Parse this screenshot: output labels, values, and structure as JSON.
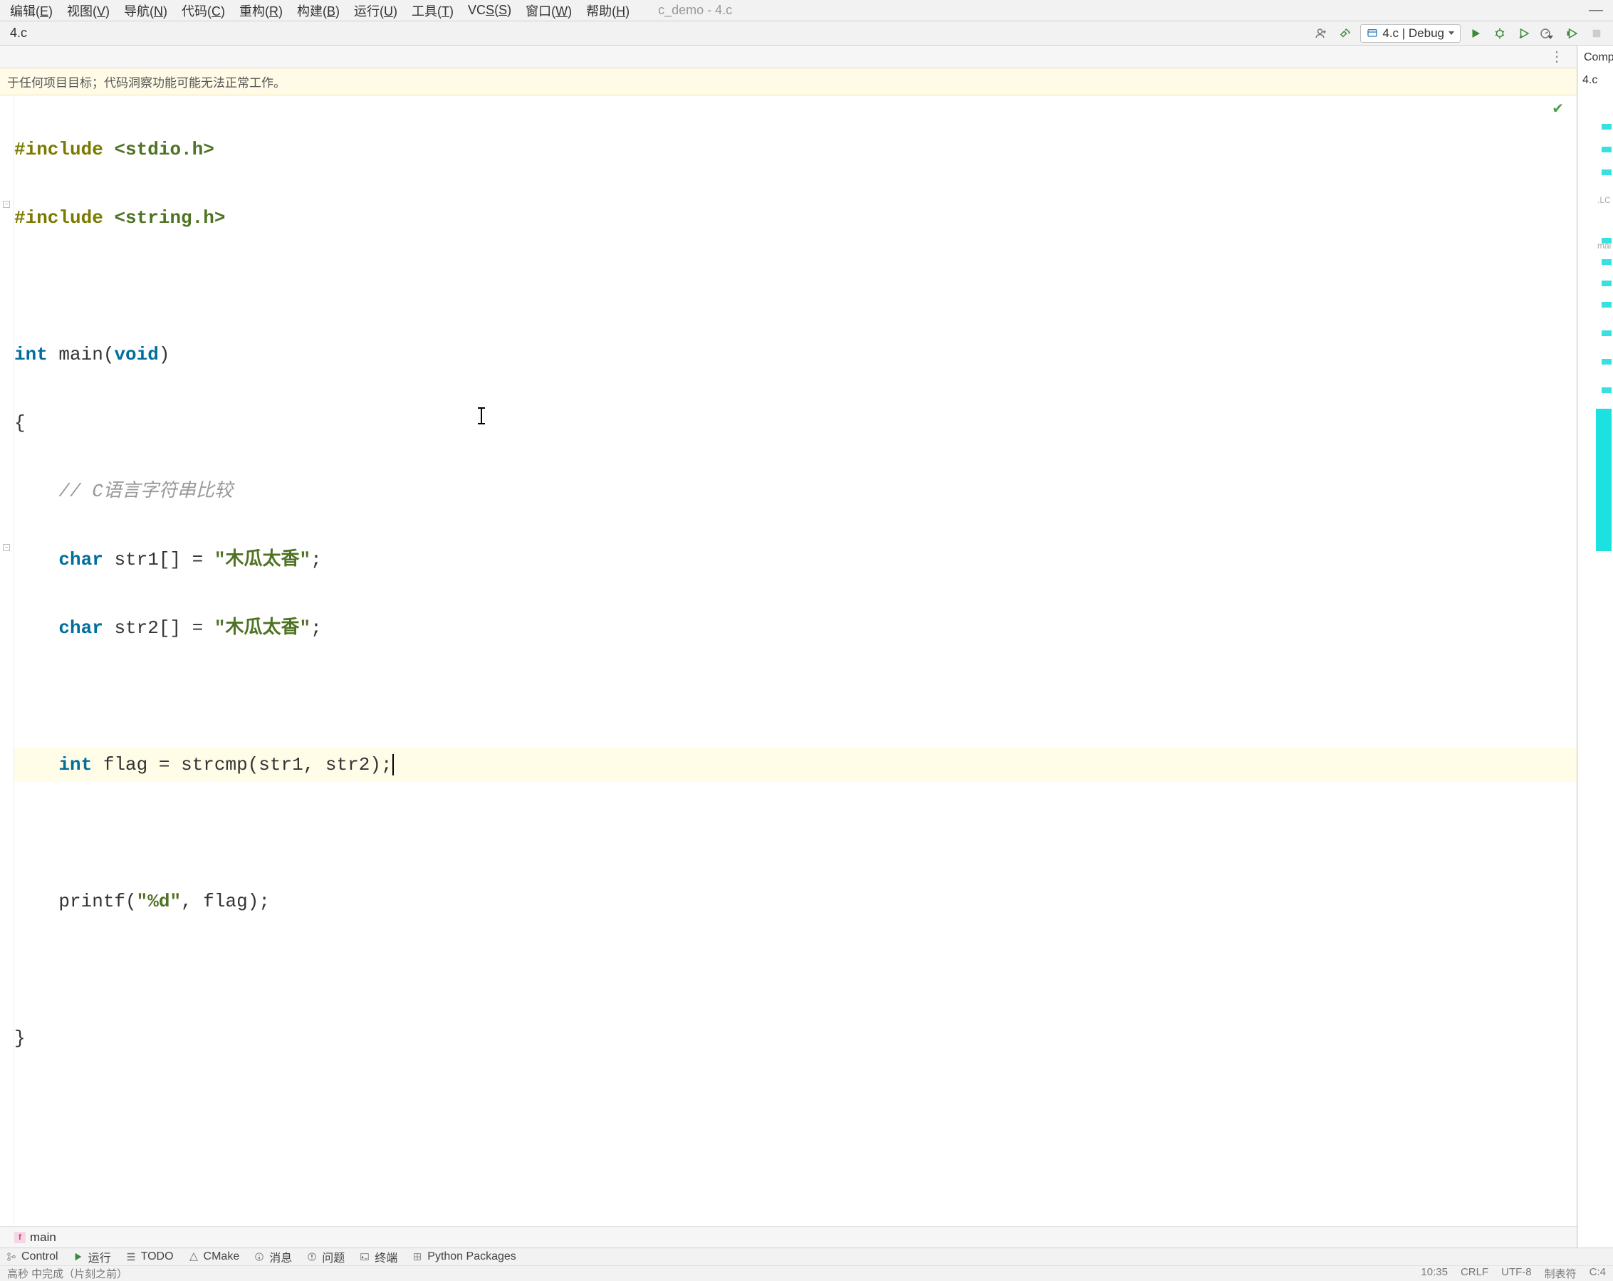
{
  "menubar": {
    "items": [
      {
        "label": "编辑",
        "accel": "E"
      },
      {
        "label": "视图",
        "accel": "V"
      },
      {
        "label": "导航",
        "accel": "N"
      },
      {
        "label": "代码",
        "accel": "C"
      },
      {
        "label": "重构",
        "accel": "R"
      },
      {
        "label": "构建",
        "accel": "B"
      },
      {
        "label": "运行",
        "accel": "U"
      },
      {
        "label": "工具",
        "accel": "T"
      },
      {
        "label": "VCS",
        "accel": "S",
        "prefix": ""
      },
      {
        "label": "窗口",
        "accel": "W"
      },
      {
        "label": "帮助",
        "accel": "H"
      }
    ],
    "project_title": "c_demo - 4.c"
  },
  "file_tab": "4.c",
  "run_config": {
    "label": "4.c | Debug"
  },
  "warning_banner": "于任何项目目标；代码洞察功能可能无法正常工作。",
  "code": {
    "lines": [
      {
        "type": "pp",
        "text_a": "#include ",
        "text_b": "<stdio.h>"
      },
      {
        "type": "pp",
        "text_a": "#include ",
        "text_b": "<string.h>"
      },
      {
        "type": "blank"
      },
      {
        "type": "sig",
        "kw1": "int",
        "fn": "main",
        "kw2": "void"
      },
      {
        "type": "brace_open"
      },
      {
        "type": "cmt",
        "text": "// C语言字符串比较"
      },
      {
        "type": "decl",
        "kw": "char",
        "var": "str1[]",
        "val": "\"木瓜太香\""
      },
      {
        "type": "decl",
        "kw": "char",
        "var": "str2[]",
        "val": "\"木瓜太香\""
      },
      {
        "type": "blank"
      },
      {
        "type": "flag",
        "kw": "int",
        "var": "flag",
        "call": "strcmp(str1, str2)",
        "highlight": true
      },
      {
        "type": "blank"
      },
      {
        "type": "print",
        "fn": "printf",
        "fmt": "\"%d\"",
        "arg": "flag"
      },
      {
        "type": "blank"
      },
      {
        "type": "brace_close"
      }
    ]
  },
  "right_panel": {
    "top_label": "Comp",
    "file_label": "4.c",
    "mini_labels": [
      ".LC",
      "mai"
    ]
  },
  "breadcrumb": {
    "fn": "main"
  },
  "bottom_tools": [
    {
      "label": "Control",
      "icon": "branch"
    },
    {
      "label": "运行",
      "icon": "play"
    },
    {
      "label": "TODO",
      "icon": "list"
    },
    {
      "label": "CMake",
      "icon": "cmake"
    },
    {
      "label": "消息",
      "icon": "info"
    },
    {
      "label": "问题",
      "icon": "warn"
    },
    {
      "label": "终端",
      "icon": "terminal"
    },
    {
      "label": "Python Packages",
      "icon": "pkg"
    }
  ],
  "status_bar": {
    "left": "高秒 中完成（片刻之前）",
    "cursor": "10:35",
    "line_sep": "CRLF",
    "encoding": "UTF-8",
    "tab_setting": "制表符",
    "context": "C:4"
  }
}
